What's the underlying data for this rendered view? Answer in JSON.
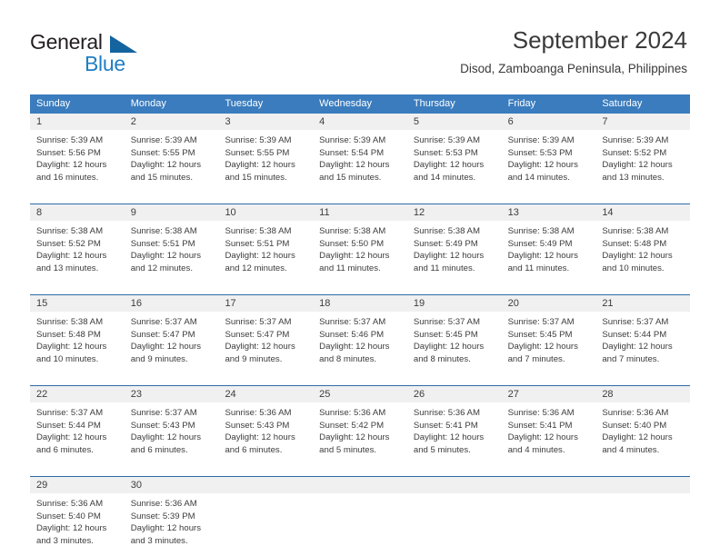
{
  "brand": {
    "name_part1": "General",
    "name_part2": "Blue",
    "triangle_color": "#1464a0",
    "blue_color": "#1f7fc4"
  },
  "header": {
    "title": "September 2024",
    "subtitle": "Disod, Zamboanga Peninsula, Philippines"
  },
  "calendar": {
    "header_bg": "#3a7cbe",
    "daynum_bg": "#f0f0f0",
    "weekdays": [
      "Sunday",
      "Monday",
      "Tuesday",
      "Wednesday",
      "Thursday",
      "Friday",
      "Saturday"
    ],
    "weeks": [
      [
        {
          "day": "1",
          "sunrise": "Sunrise: 5:39 AM",
          "sunset": "Sunset: 5:56 PM",
          "daylight1": "Daylight: 12 hours",
          "daylight2": "and 16 minutes."
        },
        {
          "day": "2",
          "sunrise": "Sunrise: 5:39 AM",
          "sunset": "Sunset: 5:55 PM",
          "daylight1": "Daylight: 12 hours",
          "daylight2": "and 15 minutes."
        },
        {
          "day": "3",
          "sunrise": "Sunrise: 5:39 AM",
          "sunset": "Sunset: 5:55 PM",
          "daylight1": "Daylight: 12 hours",
          "daylight2": "and 15 minutes."
        },
        {
          "day": "4",
          "sunrise": "Sunrise: 5:39 AM",
          "sunset": "Sunset: 5:54 PM",
          "daylight1": "Daylight: 12 hours",
          "daylight2": "and 15 minutes."
        },
        {
          "day": "5",
          "sunrise": "Sunrise: 5:39 AM",
          "sunset": "Sunset: 5:53 PM",
          "daylight1": "Daylight: 12 hours",
          "daylight2": "and 14 minutes."
        },
        {
          "day": "6",
          "sunrise": "Sunrise: 5:39 AM",
          "sunset": "Sunset: 5:53 PM",
          "daylight1": "Daylight: 12 hours",
          "daylight2": "and 14 minutes."
        },
        {
          "day": "7",
          "sunrise": "Sunrise: 5:39 AM",
          "sunset": "Sunset: 5:52 PM",
          "daylight1": "Daylight: 12 hours",
          "daylight2": "and 13 minutes."
        }
      ],
      [
        {
          "day": "8",
          "sunrise": "Sunrise: 5:38 AM",
          "sunset": "Sunset: 5:52 PM",
          "daylight1": "Daylight: 12 hours",
          "daylight2": "and 13 minutes."
        },
        {
          "day": "9",
          "sunrise": "Sunrise: 5:38 AM",
          "sunset": "Sunset: 5:51 PM",
          "daylight1": "Daylight: 12 hours",
          "daylight2": "and 12 minutes."
        },
        {
          "day": "10",
          "sunrise": "Sunrise: 5:38 AM",
          "sunset": "Sunset: 5:51 PM",
          "daylight1": "Daylight: 12 hours",
          "daylight2": "and 12 minutes."
        },
        {
          "day": "11",
          "sunrise": "Sunrise: 5:38 AM",
          "sunset": "Sunset: 5:50 PM",
          "daylight1": "Daylight: 12 hours",
          "daylight2": "and 11 minutes."
        },
        {
          "day": "12",
          "sunrise": "Sunrise: 5:38 AM",
          "sunset": "Sunset: 5:49 PM",
          "daylight1": "Daylight: 12 hours",
          "daylight2": "and 11 minutes."
        },
        {
          "day": "13",
          "sunrise": "Sunrise: 5:38 AM",
          "sunset": "Sunset: 5:49 PM",
          "daylight1": "Daylight: 12 hours",
          "daylight2": "and 11 minutes."
        },
        {
          "day": "14",
          "sunrise": "Sunrise: 5:38 AM",
          "sunset": "Sunset: 5:48 PM",
          "daylight1": "Daylight: 12 hours",
          "daylight2": "and 10 minutes."
        }
      ],
      [
        {
          "day": "15",
          "sunrise": "Sunrise: 5:38 AM",
          "sunset": "Sunset: 5:48 PM",
          "daylight1": "Daylight: 12 hours",
          "daylight2": "and 10 minutes."
        },
        {
          "day": "16",
          "sunrise": "Sunrise: 5:37 AM",
          "sunset": "Sunset: 5:47 PM",
          "daylight1": "Daylight: 12 hours",
          "daylight2": "and 9 minutes."
        },
        {
          "day": "17",
          "sunrise": "Sunrise: 5:37 AM",
          "sunset": "Sunset: 5:47 PM",
          "daylight1": "Daylight: 12 hours",
          "daylight2": "and 9 minutes."
        },
        {
          "day": "18",
          "sunrise": "Sunrise: 5:37 AM",
          "sunset": "Sunset: 5:46 PM",
          "daylight1": "Daylight: 12 hours",
          "daylight2": "and 8 minutes."
        },
        {
          "day": "19",
          "sunrise": "Sunrise: 5:37 AM",
          "sunset": "Sunset: 5:45 PM",
          "daylight1": "Daylight: 12 hours",
          "daylight2": "and 8 minutes."
        },
        {
          "day": "20",
          "sunrise": "Sunrise: 5:37 AM",
          "sunset": "Sunset: 5:45 PM",
          "daylight1": "Daylight: 12 hours",
          "daylight2": "and 7 minutes."
        },
        {
          "day": "21",
          "sunrise": "Sunrise: 5:37 AM",
          "sunset": "Sunset: 5:44 PM",
          "daylight1": "Daylight: 12 hours",
          "daylight2": "and 7 minutes."
        }
      ],
      [
        {
          "day": "22",
          "sunrise": "Sunrise: 5:37 AM",
          "sunset": "Sunset: 5:44 PM",
          "daylight1": "Daylight: 12 hours",
          "daylight2": "and 6 minutes."
        },
        {
          "day": "23",
          "sunrise": "Sunrise: 5:37 AM",
          "sunset": "Sunset: 5:43 PM",
          "daylight1": "Daylight: 12 hours",
          "daylight2": "and 6 minutes."
        },
        {
          "day": "24",
          "sunrise": "Sunrise: 5:36 AM",
          "sunset": "Sunset: 5:43 PM",
          "daylight1": "Daylight: 12 hours",
          "daylight2": "and 6 minutes."
        },
        {
          "day": "25",
          "sunrise": "Sunrise: 5:36 AM",
          "sunset": "Sunset: 5:42 PM",
          "daylight1": "Daylight: 12 hours",
          "daylight2": "and 5 minutes."
        },
        {
          "day": "26",
          "sunrise": "Sunrise: 5:36 AM",
          "sunset": "Sunset: 5:41 PM",
          "daylight1": "Daylight: 12 hours",
          "daylight2": "and 5 minutes."
        },
        {
          "day": "27",
          "sunrise": "Sunrise: 5:36 AM",
          "sunset": "Sunset: 5:41 PM",
          "daylight1": "Daylight: 12 hours",
          "daylight2": "and 4 minutes."
        },
        {
          "day": "28",
          "sunrise": "Sunrise: 5:36 AM",
          "sunset": "Sunset: 5:40 PM",
          "daylight1": "Daylight: 12 hours",
          "daylight2": "and 4 minutes."
        }
      ],
      [
        {
          "day": "29",
          "sunrise": "Sunrise: 5:36 AM",
          "sunset": "Sunset: 5:40 PM",
          "daylight1": "Daylight: 12 hours",
          "daylight2": "and 3 minutes."
        },
        {
          "day": "30",
          "sunrise": "Sunrise: 5:36 AM",
          "sunset": "Sunset: 5:39 PM",
          "daylight1": "Daylight: 12 hours",
          "daylight2": "and 3 minutes."
        },
        {
          "day": "",
          "sunrise": "",
          "sunset": "",
          "daylight1": "",
          "daylight2": ""
        },
        {
          "day": "",
          "sunrise": "",
          "sunset": "",
          "daylight1": "",
          "daylight2": ""
        },
        {
          "day": "",
          "sunrise": "",
          "sunset": "",
          "daylight1": "",
          "daylight2": ""
        },
        {
          "day": "",
          "sunrise": "",
          "sunset": "",
          "daylight1": "",
          "daylight2": ""
        },
        {
          "day": "",
          "sunrise": "",
          "sunset": "",
          "daylight1": "",
          "daylight2": ""
        }
      ]
    ]
  }
}
